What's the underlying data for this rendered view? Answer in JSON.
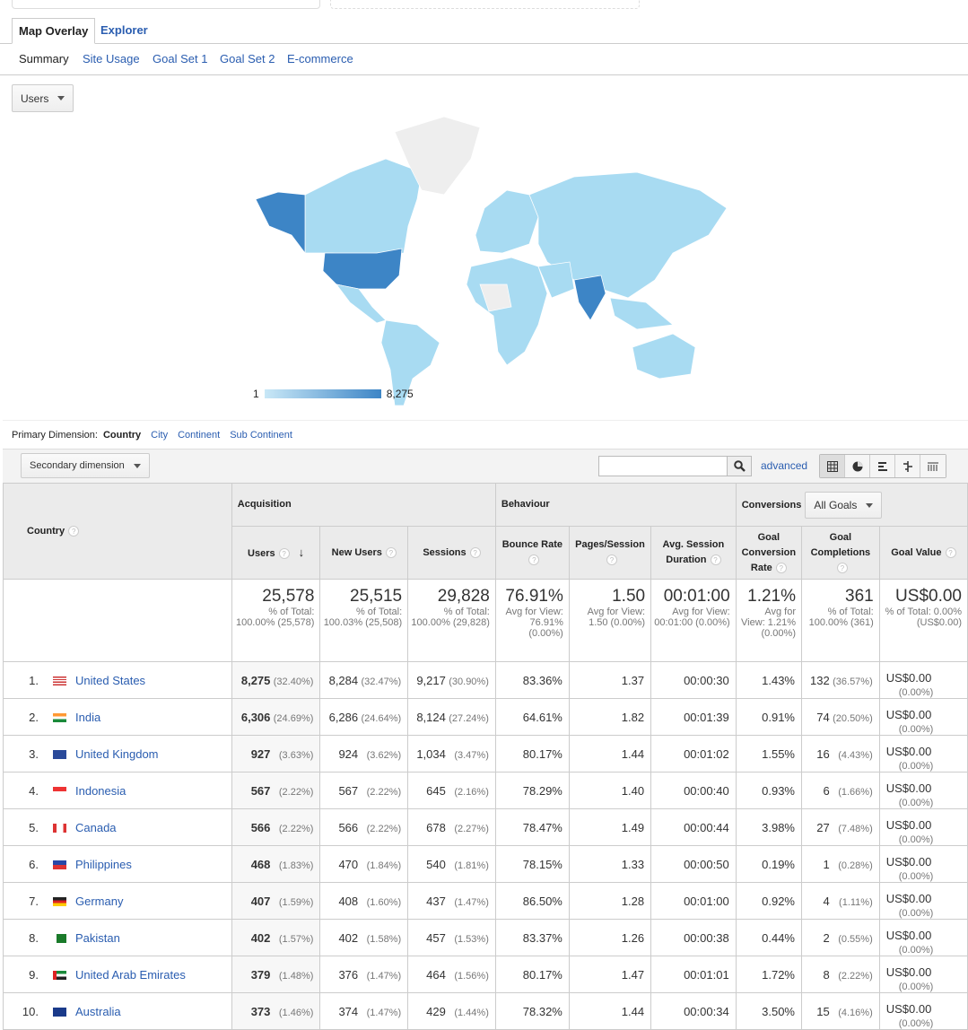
{
  "tabs": {
    "map_overlay": "Map Overlay",
    "explorer": "Explorer"
  },
  "subtabs": [
    "Summary",
    "Site Usage",
    "Goal Set 1",
    "Goal Set 2",
    "E-commerce"
  ],
  "metric_select": "Users",
  "map": {
    "legend_min": "1",
    "legend_max": "8,275",
    "color_low": "#c9e8f7",
    "color_high": "#3d85c6",
    "highlighted": [
      "United States",
      "India"
    ]
  },
  "primary_dimension": {
    "label": "Primary Dimension:",
    "active": "Country",
    "options": [
      "City",
      "Continent",
      "Sub Continent"
    ]
  },
  "secondary_dimension": "Secondary dimension",
  "search": {
    "value": "",
    "advanced": "advanced"
  },
  "table": {
    "country_header": "Country",
    "groups": {
      "acquisition": "Acquisition",
      "behaviour": "Behaviour",
      "conversions": "Conversions",
      "goals_select": "All Goals"
    },
    "columns": [
      "Users",
      "New Users",
      "Sessions",
      "Bounce Rate",
      "Pages/Session",
      "Avg. Session Duration",
      "Goal Conversion Rate",
      "Goal Completions",
      "Goal Value"
    ],
    "totals": [
      {
        "value": "25,578",
        "note": "% of Total: 100.00% (25,578)"
      },
      {
        "value": "25,515",
        "note": "% of Total: 100.03% (25,508)"
      },
      {
        "value": "29,828",
        "note": "% of Total: 100.00% (29,828)"
      },
      {
        "value": "76.91%",
        "note": "Avg for View: 76.91% (0.00%)"
      },
      {
        "value": "1.50",
        "note": "Avg for View: 1.50 (0.00%)"
      },
      {
        "value": "00:01:00",
        "note": "Avg for View: 00:01:00 (0.00%)"
      },
      {
        "value": "1.21%",
        "note": "Avg for View: 1.21% (0.00%)"
      },
      {
        "value": "361",
        "note": "% of Total: 100.00% (361)"
      },
      {
        "value": "US$0.00",
        "note": "% of Total: 0.00% (US$0.00)"
      }
    ],
    "rows": [
      {
        "n": "1.",
        "country": "United States",
        "flag": "us",
        "users": "8,275",
        "users_pct": "(32.40%)",
        "new": "8,284",
        "new_pct": "(32.47%)",
        "sessions": "9,217",
        "sessions_pct": "(30.90%)",
        "bounce": "83.36%",
        "pages": "1.37",
        "duration": "00:00:30",
        "conv": "1.43%",
        "goals": "132",
        "goals_pct": "(36.57%)",
        "value": "US$0.00",
        "value_pct": "(0.00%)"
      },
      {
        "n": "2.",
        "country": "India",
        "flag": "in",
        "users": "6,306",
        "users_pct": "(24.69%)",
        "new": "6,286",
        "new_pct": "(24.64%)",
        "sessions": "8,124",
        "sessions_pct": "(27.24%)",
        "bounce": "64.61%",
        "pages": "1.82",
        "duration": "00:01:39",
        "conv": "0.91%",
        "goals": "74",
        "goals_pct": "(20.50%)",
        "value": "US$0.00",
        "value_pct": "(0.00%)"
      },
      {
        "n": "3.",
        "country": "United Kingdom",
        "flag": "gb",
        "users": "927",
        "users_pct": "(3.63%)",
        "new": "924",
        "new_pct": "(3.62%)",
        "sessions": "1,034",
        "sessions_pct": "(3.47%)",
        "bounce": "80.17%",
        "pages": "1.44",
        "duration": "00:01:02",
        "conv": "1.55%",
        "goals": "16",
        "goals_pct": "(4.43%)",
        "value": "US$0.00",
        "value_pct": "(0.00%)"
      },
      {
        "n": "4.",
        "country": "Indonesia",
        "flag": "id",
        "users": "567",
        "users_pct": "(2.22%)",
        "new": "567",
        "new_pct": "(2.22%)",
        "sessions": "645",
        "sessions_pct": "(2.16%)",
        "bounce": "78.29%",
        "pages": "1.40",
        "duration": "00:00:40",
        "conv": "0.93%",
        "goals": "6",
        "goals_pct": "(1.66%)",
        "value": "US$0.00",
        "value_pct": "(0.00%)"
      },
      {
        "n": "5.",
        "country": "Canada",
        "flag": "ca",
        "users": "566",
        "users_pct": "(2.22%)",
        "new": "566",
        "new_pct": "(2.22%)",
        "sessions": "678",
        "sessions_pct": "(2.27%)",
        "bounce": "78.47%",
        "pages": "1.49",
        "duration": "00:00:44",
        "conv": "3.98%",
        "goals": "27",
        "goals_pct": "(7.48%)",
        "value": "US$0.00",
        "value_pct": "(0.00%)"
      },
      {
        "n": "6.",
        "country": "Philippines",
        "flag": "ph",
        "users": "468",
        "users_pct": "(1.83%)",
        "new": "470",
        "new_pct": "(1.84%)",
        "sessions": "540",
        "sessions_pct": "(1.81%)",
        "bounce": "78.15%",
        "pages": "1.33",
        "duration": "00:00:50",
        "conv": "0.19%",
        "goals": "1",
        "goals_pct": "(0.28%)",
        "value": "US$0.00",
        "value_pct": "(0.00%)"
      },
      {
        "n": "7.",
        "country": "Germany",
        "flag": "de",
        "users": "407",
        "users_pct": "(1.59%)",
        "new": "408",
        "new_pct": "(1.60%)",
        "sessions": "437",
        "sessions_pct": "(1.47%)",
        "bounce": "86.50%",
        "pages": "1.28",
        "duration": "00:01:00",
        "conv": "0.92%",
        "goals": "4",
        "goals_pct": "(1.11%)",
        "value": "US$0.00",
        "value_pct": "(0.00%)"
      },
      {
        "n": "8.",
        "country": "Pakistan",
        "flag": "pk",
        "users": "402",
        "users_pct": "(1.57%)",
        "new": "402",
        "new_pct": "(1.58%)",
        "sessions": "457",
        "sessions_pct": "(1.53%)",
        "bounce": "83.37%",
        "pages": "1.26",
        "duration": "00:00:38",
        "conv": "0.44%",
        "goals": "2",
        "goals_pct": "(0.55%)",
        "value": "US$0.00",
        "value_pct": "(0.00%)"
      },
      {
        "n": "9.",
        "country": "United Arab Emirates",
        "flag": "ae",
        "users": "379",
        "users_pct": "(1.48%)",
        "new": "376",
        "new_pct": "(1.47%)",
        "sessions": "464",
        "sessions_pct": "(1.56%)",
        "bounce": "80.17%",
        "pages": "1.47",
        "duration": "00:01:01",
        "conv": "1.72%",
        "goals": "8",
        "goals_pct": "(2.22%)",
        "value": "US$0.00",
        "value_pct": "(0.00%)"
      },
      {
        "n": "10.",
        "country": "Australia",
        "flag": "au",
        "users": "373",
        "users_pct": "(1.46%)",
        "new": "374",
        "new_pct": "(1.47%)",
        "sessions": "429",
        "sessions_pct": "(1.44%)",
        "bounce": "78.32%",
        "pages": "1.44",
        "duration": "00:00:34",
        "conv": "3.50%",
        "goals": "15",
        "goals_pct": "(4.16%)",
        "value": "US$0.00",
        "value_pct": "(0.00%)"
      }
    ]
  }
}
